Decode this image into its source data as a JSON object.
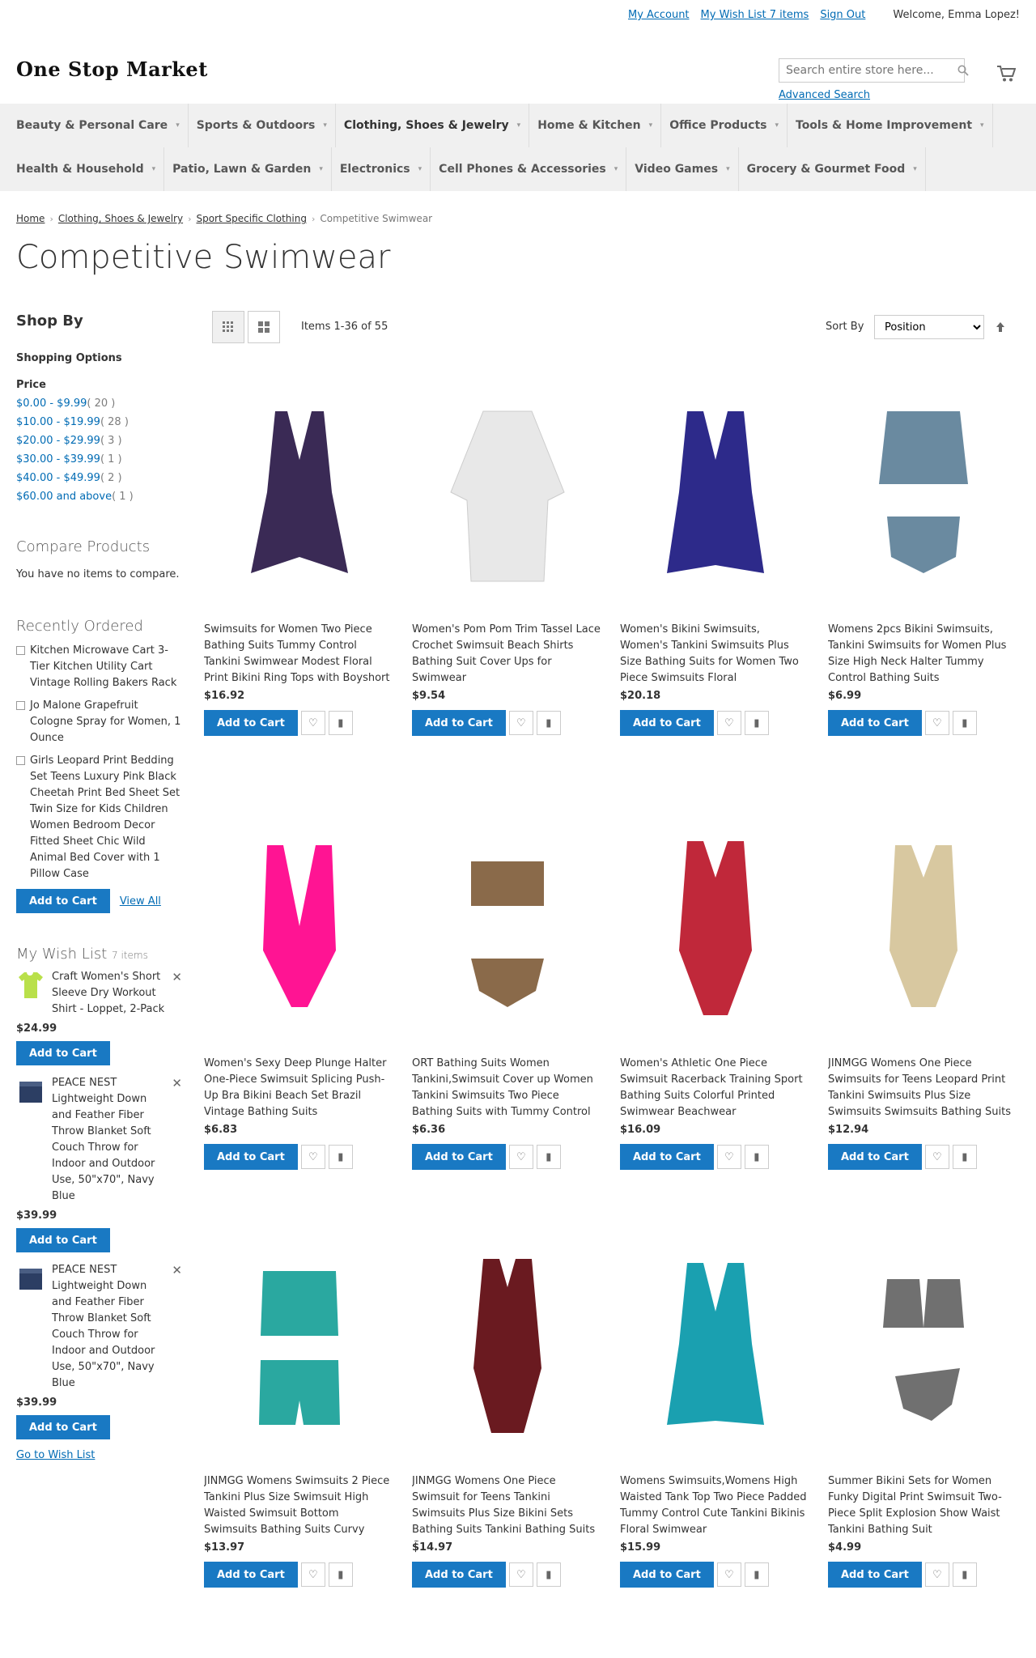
{
  "header": {
    "links": [
      "My Account",
      "My Wish List 7 items",
      "Sign Out"
    ],
    "welcome": "Welcome, Emma Lopez!",
    "logo": "One Stop Market",
    "search_placeholder": "Search entire store here...",
    "advanced_search": "Advanced Search"
  },
  "nav": {
    "row1": [
      "Beauty & Personal Care",
      "Sports & Outdoors",
      "Clothing, Shoes & Jewelry",
      "Home & Kitchen",
      "Office Products",
      "Tools & Home Improvement"
    ],
    "row2": [
      "Health & Household",
      "Patio, Lawn & Garden",
      "Electronics",
      "Cell Phones & Accessories",
      "Video Games",
      "Grocery & Gourmet Food"
    ]
  },
  "breadcrumb": [
    "Home",
    "Clothing, Shoes & Jewelry",
    "Sport Specific Clothing",
    "Competitive Swimwear"
  ],
  "page_title": "Competitive Swimwear",
  "sidebar": {
    "shop_by": "Shop By",
    "shopping_options": "Shopping Options",
    "price_title": "Price",
    "prices": [
      {
        "range": "$0.00 - $9.99",
        "count": "( 20 )"
      },
      {
        "range": "$10.00 - $19.99",
        "count": "( 28 )"
      },
      {
        "range": "$20.00 - $29.99",
        "count": "( 3 )"
      },
      {
        "range": "$30.00 - $39.99",
        "count": "( 1 )"
      },
      {
        "range": "$40.00 - $49.99",
        "count": "( 2 )"
      },
      {
        "range": "$60.00 and above",
        "count": "( 1 )"
      }
    ],
    "compare_title": "Compare Products",
    "compare_text": "You have no items to compare.",
    "recent_title": "Recently Ordered",
    "recent": [
      "Kitchen Microwave Cart 3-Tier Kitchen Utility Cart Vintage Rolling Bakers Rack",
      "Jo Malone Grapefruit Cologne Spray for Women, 1 Ounce",
      "Girls Leopard Print Bedding Set Teens Luxury Pink Black Cheetah Print Bed Sheet Set Twin Size for Kids Children Women Bedroom Decor Fitted Sheet Chic Wild Animal Bed Cover with 1 Pillow Case"
    ],
    "add_to_cart": "Add to Cart",
    "view_all": "View All",
    "wishlist_title": "My Wish List",
    "wishlist_count": "7 items",
    "wishlist": [
      {
        "name": "Craft Women's Short Sleeve Dry Workout Shirt - Loppet, 2-Pack",
        "price": "$24.99"
      },
      {
        "name": "PEACE NEST Lightweight Down and Feather Fiber Throw Blanket Soft Couch Throw for Indoor and Outdoor Use, 50\"x70\", Navy Blue",
        "price": "$39.99"
      },
      {
        "name": "PEACE NEST Lightweight Down and Feather Fiber Throw Blanket Soft Couch Throw for Indoor and Outdoor Use, 50\"x70\", Navy Blue",
        "price": "$39.99"
      }
    ],
    "go_to_wishlist": "Go to Wish List"
  },
  "toolbar": {
    "amount": "Items 1-36 of 55",
    "sort_label": "Sort By",
    "sort_value": "Position"
  },
  "products": [
    {
      "name": "Swimsuits for Women Two Piece Bathing Suits Tummy Control Tankini Swimwear Modest Floral Print Bikini Ring Tops with Boyshort",
      "price": "$16.92",
      "color": "#3a2a55"
    },
    {
      "name": "Women's Pom Pom Trim Tassel Lace Crochet Swimsuit Beach Shirts Bathing Suit Cover Ups for Swimwear",
      "price": "$9.54",
      "color": "#e8e8e8"
    },
    {
      "name": "Women's Bikini Swimsuits, Women's Tankini Swimsuits Plus Size Bathing Suits for Women Two Piece Swimsuits Floral",
      "price": "$20.18",
      "color": "#2d2a8a"
    },
    {
      "name": "Womens 2pcs Bikini Swimsuits, Tankini Swimsuits for Women Plus Size High Neck Halter Tummy Control Bathing Suits",
      "price": "$6.99",
      "color": "#6a8aa0"
    },
    {
      "name": "Women's Sexy Deep Plunge Halter One-Piece Swimsuit Splicing Push-Up Bra Bikini Beach Set Brazil Vintage Bathing Suits",
      "price": "$6.83",
      "color": "#ff1493"
    },
    {
      "name": "ORT Bathing Suits Women Tankini,Swimsuit Cover up Women Tankini Swimsuits Two Piece Bathing Suits with Tummy Control",
      "price": "$6.36",
      "color": "#8a6a4a"
    },
    {
      "name": "Women's Athletic One Piece Swimsuit Racerback Training Sport Bathing Suits Colorful Printed Swimwear Beachwear",
      "price": "$16.09",
      "color": "#c0283a"
    },
    {
      "name": "JINMGG Womens One Piece Swimsuits for Teens Leopard Print Tankini Swimsuits Plus Size Swimsuits Swimsuits Bathing Suits",
      "price": "$12.94",
      "color": "#d8c8a0"
    },
    {
      "name": "JINMGG Womens Swimsuits 2 Piece Tankini Plus Size Swimsuit High Waisted Swimsuit Bottom Swimsuits Bathing Suits Curvy",
      "price": "$13.97",
      "color": "#2aa8a0"
    },
    {
      "name": "JINMGG Womens One Piece Swimsuit for Teens Tankini Swimsuits Plus Size Bikini Sets Bathing Suits Tankini Bathing Suits Curvy",
      "price": "$14.97",
      "color": "#6a1a20"
    },
    {
      "name": "Womens Swimsuits,Womens High Waisted Tank Top Two Piece Padded Tummy Control Cute Tankini Bikinis Floral Swimwear",
      "price": "$15.99",
      "color": "#1aa0b0"
    },
    {
      "name": "Summer Bikini Sets for Women Funky Digital Print Swimsuit Two-Piece Split Explosion Show Waist Tankini Bathing Suit",
      "price": "$4.99",
      "color": "#707070"
    }
  ]
}
